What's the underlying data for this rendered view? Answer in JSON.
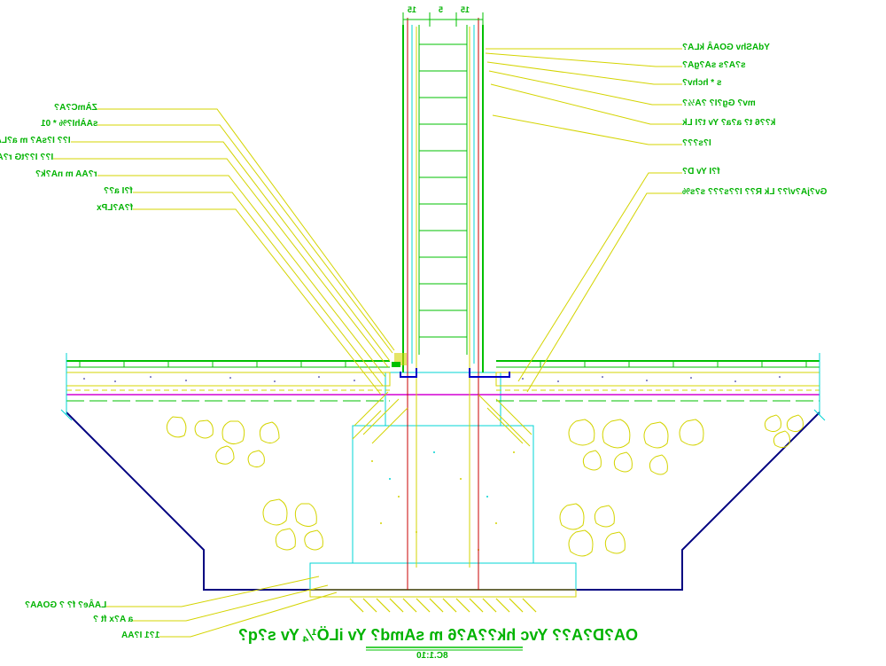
{
  "drawing": {
    "title": "OA?D?A?? Yvc hk??A?6 m sAmd? Yv iLÖ¼ Yv s?q?",
    "scale": "8C.1:10",
    "sub_note": "1?1 I?AA"
  },
  "dimensions": {
    "top_left": "15",
    "top_mid": "5",
    "top_right": "15"
  },
  "left_labels": [
    "ZÀmC?A?",
    "sAÀhI?% * 01",
    "I?? I?sA? m a?LA?s",
    "I?? I??tG r?AA m nA?k?",
    "r?AA m nA?k?",
    "f?I a??",
    "f?A?LPx"
  ],
  "right_labels": [
    "YdAShv GOAÂ kLA?",
    "s?A?s sA?gA?",
    "s * hchv?",
    "mv? Gg?I? ?A½?",
    "k??6 t? a?a? Yv t?I Lk",
    "I?s???",
    "f?I Yv D?",
    "Gv?jA?v/?? Lk R?? I??s??? s?s%"
  ],
  "bottom_labels": [
    "LAÂe? f? ? GOAA?",
    "a A?x ft ?"
  ],
  "colors": {
    "green": "#00c000",
    "yellow": "#d4d400",
    "cyan": "#00d4d4",
    "blue": "#0000c8",
    "magenta": "#d400d4",
    "red": "#c80000",
    "navy": "#000080"
  }
}
